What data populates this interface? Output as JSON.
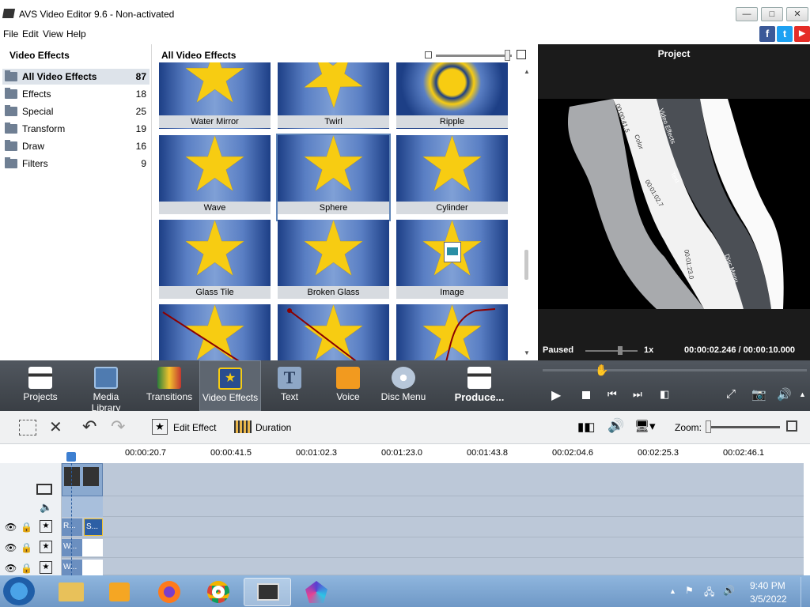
{
  "window": {
    "title": "AVS Video Editor 9.6 - Non-activated",
    "controls": [
      "—",
      "□",
      "✕"
    ]
  },
  "menu": [
    "File",
    "Edit",
    "View",
    "Help"
  ],
  "social": [
    "f",
    "t",
    "▶"
  ],
  "categories": {
    "header": "Video Effects",
    "items": [
      {
        "label": "All Video Effects",
        "count": "87"
      },
      {
        "label": "Effects",
        "count": "18"
      },
      {
        "label": "Special",
        "count": "25"
      },
      {
        "label": "Transform",
        "count": "19"
      },
      {
        "label": "Draw",
        "count": "16"
      },
      {
        "label": "Filters",
        "count": "9"
      }
    ]
  },
  "grid": {
    "header": "All Video Effects",
    "tiles": [
      "Water Mirror",
      "Twirl",
      "Ripple",
      "Wave",
      "Sphere",
      "Cylinder",
      "Glass Tile",
      "Broken Glass",
      "Image",
      "",
      "",
      ""
    ]
  },
  "project": {
    "header": "Project",
    "status": "Paused",
    "speed": "1x",
    "time": "00:00:02.246 / 00:00:10.000",
    "video_texts": [
      "00:00:41.5",
      "Color",
      "Video Effects",
      "Text",
      "00:01:02.7",
      "00:01:23.0",
      "Disc Menu"
    ]
  },
  "toolbar": [
    {
      "label": "Projects"
    },
    {
      "label": "Media Library"
    },
    {
      "label": "Transitions"
    },
    {
      "label": "Video Effects"
    },
    {
      "label": "Text"
    },
    {
      "label": "Voice"
    },
    {
      "label": "Disc Menu"
    },
    {
      "label": "Produce..."
    }
  ],
  "edit_toolbar": {
    "edit_effect": "Edit Effect",
    "duration": "Duration",
    "zoom": "Zoom:"
  },
  "timeline": {
    "ruler": [
      "00:00:20.7",
      "00:00:41.5",
      "00:01:02.3",
      "00:01:23.0",
      "00:01:43.8",
      "00:02:04.6",
      "00:02:25.3",
      "00:02:46.1"
    ],
    "clips": [
      "R...",
      "S...",
      "W...",
      "W..."
    ]
  },
  "taskbar": {
    "time": "9:40 PM",
    "date": "3/5/2022"
  },
  "colors": {
    "accent": "#5e84b8",
    "toolbar": "#464c53",
    "star": "#f7cc12"
  }
}
